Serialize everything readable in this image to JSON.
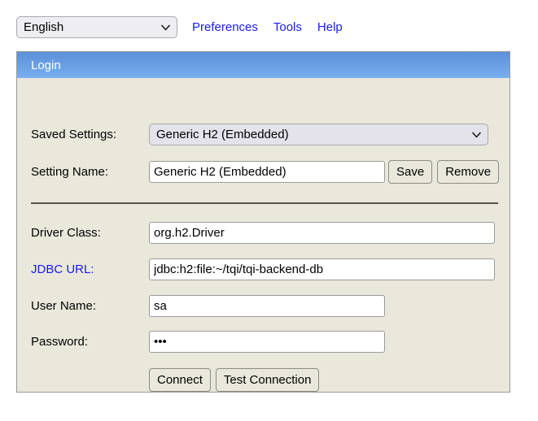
{
  "toolbar": {
    "language_select": {
      "value": "English",
      "options": [
        "English"
      ]
    },
    "links": [
      {
        "label": "Preferences"
      },
      {
        "label": "Tools"
      },
      {
        "label": "Help"
      }
    ]
  },
  "panel": {
    "header_title": "Login",
    "saved_settings": {
      "label": "Saved Settings:",
      "value": "Generic H2 (Embedded)",
      "options": [
        "Generic H2 (Embedded)"
      ]
    },
    "setting_name": {
      "label": "Setting Name:",
      "value": "Generic H2 (Embedded)",
      "save_label": "Save",
      "remove_label": "Remove"
    },
    "driver_class": {
      "label": "Driver Class:",
      "value": "org.h2.Driver"
    },
    "jdbc_url": {
      "label": "JDBC URL:",
      "value": "jdbc:h2:file:~/tqi/tqi-backend-db"
    },
    "user_name": {
      "label": "User Name:",
      "value": "sa"
    },
    "password": {
      "label": "Password:",
      "value": "•••"
    },
    "actions": {
      "connect_label": "Connect",
      "test_connection_label": "Test Connection"
    }
  },
  "colors": {
    "panel_bg": "#eae8da",
    "header_blue_top": "#5b90d8",
    "header_blue_bottom": "#79aff0",
    "link_blue": "#1a1aff",
    "divider": "#55534b"
  }
}
